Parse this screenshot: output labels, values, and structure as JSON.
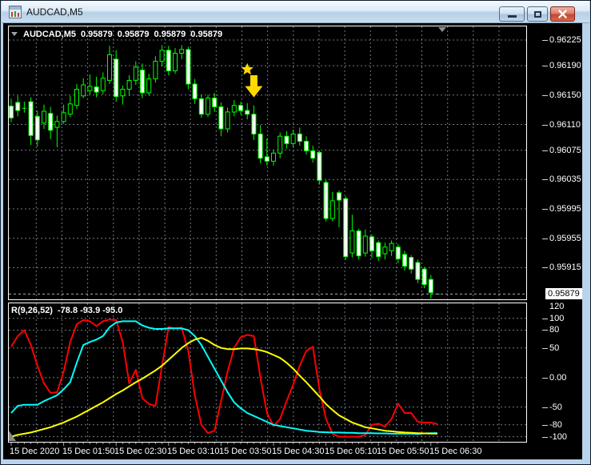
{
  "window": {
    "title": "AUDCAD,M5",
    "buttons": {
      "minimize": "minimize",
      "restore": "restore",
      "close": "close"
    }
  },
  "legend": {
    "symbol": "AUDCAD,M5",
    "open": "0.95879",
    "high": "0.95879",
    "low": "0.95879",
    "close": "0.95879"
  },
  "indicator": {
    "label": "R(9,26,52)",
    "values_text": "-78.8 -93.9 -95.0",
    "axis_labels": [
      "120",
      "100",
      "80",
      "50",
      "0.00",
      "-50",
      "-80",
      "-100"
    ]
  },
  "price_axis": {
    "labels": [
      "0.96225",
      "0.96190",
      "0.96150",
      "0.96110",
      "0.96075",
      "0.96035",
      "0.95995",
      "0.95955",
      "0.95915"
    ],
    "current": "0.95879"
  },
  "time_axis": {
    "labels": [
      {
        "text": "15 Dec 2020",
        "candle_index": 0
      },
      {
        "text": "15 Dec 01:50",
        "candle_index": 8
      },
      {
        "text": "15 Dec 02:30",
        "candle_index": 16
      },
      {
        "text": "15 Dec 03:10",
        "candle_index": 24
      },
      {
        "text": "15 Dec 03:50",
        "candle_index": 32
      },
      {
        "text": "15 Dec 04:30",
        "candle_index": 40
      },
      {
        "text": "15 Dec 05:10",
        "candle_index": 48
      },
      {
        "text": "15 Dec 05:50",
        "candle_index": 56
      },
      {
        "text": "15 Dec 06:30",
        "candle_index": 64
      }
    ]
  },
  "markers": {
    "star": {
      "candle_index": 36,
      "price": 0.96185
    },
    "arrow": {
      "candle_index": 37,
      "top_price": 0.96177,
      "tip_price": 0.96147
    },
    "shift_triangle_x": 552
  },
  "colors": {
    "background": "#000000",
    "border": "#ffffff",
    "grid": "#6e7a88",
    "candle_outline": "#00ff00",
    "bear_fill": "#ffffff",
    "bull_fill": "#000000",
    "price_line": "#a8adb5",
    "r9": "#ff0000",
    "r26": "#00ffff",
    "r52": "#ffff00",
    "marker": "#ffd800",
    "axis_text": "#ffffff"
  },
  "chart_data": [
    {
      "type": "candlestick",
      "title": "AUDCAD,M5",
      "visible_price_range": [
        0.95872,
        0.96245
      ],
      "y_ticks": [
        0.96225,
        0.9619,
        0.9615,
        0.9611,
        0.96075,
        0.96035,
        0.95995,
        0.95955,
        0.95915
      ],
      "current_price": 0.95879,
      "candles": [
        [
          0.96135,
          0.96145,
          0.96113,
          0.96119
        ],
        [
          0.9614,
          0.96149,
          0.96121,
          0.96129
        ],
        [
          0.96132,
          0.96141,
          0.96126,
          0.96133
        ],
        [
          0.96141,
          0.96147,
          0.96082,
          0.96095
        ],
        [
          0.96121,
          0.96129,
          0.9608,
          0.96089
        ],
        [
          0.96112,
          0.96137,
          0.96104,
          0.96128
        ],
        [
          0.96125,
          0.96134,
          0.9609,
          0.96102
        ],
        [
          0.96106,
          0.96122,
          0.96079,
          0.96114
        ],
        [
          0.96114,
          0.96137,
          0.96111,
          0.96126
        ],
        [
          0.96124,
          0.96149,
          0.9612,
          0.96138
        ],
        [
          0.96136,
          0.96165,
          0.96131,
          0.96158
        ],
        [
          0.96149,
          0.96173,
          0.96146,
          0.96164
        ],
        [
          0.96156,
          0.96178,
          0.96151,
          0.96162
        ],
        [
          0.96161,
          0.96175,
          0.96147,
          0.96154
        ],
        [
          0.96156,
          0.96181,
          0.96151,
          0.96173
        ],
        [
          0.9617,
          0.96217,
          0.96165,
          0.96205
        ],
        [
          0.96199,
          0.96211,
          0.96141,
          0.96148
        ],
        [
          0.96149,
          0.96163,
          0.96137,
          0.96158
        ],
        [
          0.96158,
          0.96177,
          0.96149,
          0.9617
        ],
        [
          0.9617,
          0.96196,
          0.96164,
          0.96188
        ],
        [
          0.96184,
          0.96193,
          0.96146,
          0.96153
        ],
        [
          0.96153,
          0.96179,
          0.96149,
          0.96172
        ],
        [
          0.96172,
          0.96203,
          0.96167,
          0.96196
        ],
        [
          0.96196,
          0.96218,
          0.96189,
          0.96211
        ],
        [
          0.96211,
          0.96217,
          0.96177,
          0.96183
        ],
        [
          0.96183,
          0.96214,
          0.96179,
          0.96207
        ],
        [
          0.96207,
          0.96218,
          0.96199,
          0.96212
        ],
        [
          0.96212,
          0.96216,
          0.96158,
          0.96165
        ],
        [
          0.96165,
          0.96172,
          0.96138,
          0.96145
        ],
        [
          0.96145,
          0.96151,
          0.96119,
          0.96124
        ],
        [
          0.96124,
          0.9615,
          0.9612,
          0.96146
        ],
        [
          0.96146,
          0.96153,
          0.96127,
          0.96134
        ],
        [
          0.96134,
          0.9614,
          0.96094,
          0.96104
        ],
        [
          0.96104,
          0.96133,
          0.96099,
          0.96127
        ],
        [
          0.96127,
          0.96143,
          0.96121,
          0.96136
        ],
        [
          0.96136,
          0.96141,
          0.96123,
          0.96129
        ],
        [
          0.96129,
          0.96139,
          0.96117,
          0.96124
        ],
        [
          0.96124,
          0.96136,
          0.96089,
          0.96097
        ],
        [
          0.96097,
          0.96109,
          0.96057,
          0.96064
        ],
        [
          0.96066,
          0.96091,
          0.96054,
          0.9606
        ],
        [
          0.9606,
          0.96076,
          0.96054,
          0.96071
        ],
        [
          0.96071,
          0.96099,
          0.96064,
          0.96094
        ],
        [
          0.96094,
          0.96101,
          0.96077,
          0.96084
        ],
        [
          0.96084,
          0.96103,
          0.96079,
          0.96097
        ],
        [
          0.96097,
          0.96106,
          0.96081,
          0.96087
        ],
        [
          0.96087,
          0.96094,
          0.96069,
          0.96074
        ],
        [
          0.96074,
          0.96081,
          0.96058,
          0.96064
        ],
        [
          0.96072,
          0.96074,
          0.96028,
          0.96034
        ],
        [
          0.96031,
          0.96034,
          0.95978,
          0.95982
        ],
        [
          0.95982,
          0.96018,
          0.95978,
          0.96006
        ],
        [
          0.96017,
          0.9602,
          0.9597,
          0.96007
        ],
        [
          0.96009,
          0.96012,
          0.95926,
          0.9593
        ],
        [
          0.95935,
          0.95987,
          0.95929,
          0.95965
        ],
        [
          0.95965,
          0.95968,
          0.95926,
          0.95931
        ],
        [
          0.95935,
          0.95967,
          0.9593,
          0.95958
        ],
        [
          0.95957,
          0.9596,
          0.95928,
          0.95938
        ],
        [
          0.95949,
          0.95952,
          0.95924,
          0.9593
        ],
        [
          0.95934,
          0.95949,
          0.95926,
          0.95943
        ],
        [
          0.95938,
          0.95952,
          0.95931,
          0.95948
        ],
        [
          0.95943,
          0.95947,
          0.95921,
          0.95927
        ],
        [
          0.95933,
          0.95938,
          0.95911,
          0.95917
        ],
        [
          0.95929,
          0.95932,
          0.95907,
          0.95913
        ],
        [
          0.95922,
          0.95926,
          0.95894,
          0.95899
        ],
        [
          0.95913,
          0.95916,
          0.95887,
          0.95892
        ],
        [
          0.95899,
          0.95905,
          0.95873,
          0.95881
        ],
        [
          0.95879,
          0.95879,
          0.95879,
          0.95879
        ]
      ]
    },
    {
      "type": "line",
      "title": "R(9,26,52)",
      "ylim": [
        -109,
        127
      ],
      "y_ticks": [
        120,
        100,
        80,
        50,
        0,
        -50,
        -80,
        -100
      ],
      "current_values": [
        -78.8,
        -93.9,
        -95.0
      ],
      "series": [
        {
          "name": "R9",
          "color": "#ff0000",
          "values": [
            52,
            70,
            80,
            55,
            20,
            -10,
            -26,
            -25,
            10,
            60,
            90,
            97,
            95,
            87,
            95,
            98,
            97,
            60,
            -10,
            13,
            -35,
            -45,
            -48,
            20,
            85,
            83,
            84,
            45,
            -30,
            -80,
            -94,
            -90,
            -40,
            10,
            50,
            68,
            72,
            70,
            0,
            -60,
            -82,
            -70,
            -40,
            -12,
            20,
            45,
            52,
            -20,
            -70,
            -95,
            -100,
            -100,
            -100,
            -100,
            -97,
            -80,
            -78,
            -83,
            -70,
            -44,
            -60,
            -60,
            -75,
            -76,
            -76,
            -78.8
          ]
        },
        {
          "name": "R26",
          "color": "#00ffff",
          "values": [
            -60,
            -48,
            -46,
            -46,
            -46,
            -40,
            -35,
            -30,
            -20,
            -8,
            25,
            55,
            60,
            64,
            70,
            85,
            93,
            95,
            95,
            95,
            88,
            84,
            82,
            82,
            83,
            83,
            83,
            80,
            70,
            55,
            35,
            15,
            -5,
            -25,
            -42,
            -52,
            -60,
            -65,
            -70,
            -75,
            -80,
            -82,
            -84,
            -86,
            -88,
            -90,
            -91,
            -92,
            -92.5,
            -93,
            -93,
            -93.5,
            -93.5,
            -94,
            -94,
            -94,
            -94.5,
            -94.5,
            -95,
            -95,
            -95,
            -95,
            -95.5,
            -94.5,
            -94,
            -93.9
          ]
        },
        {
          "name": "R52",
          "color": "#ffff00",
          "values": [
            -100,
            -97,
            -95,
            -93,
            -90,
            -87,
            -84,
            -80,
            -76,
            -71,
            -66,
            -60,
            -54,
            -48,
            -42,
            -35,
            -28,
            -22,
            -15,
            -8,
            -2,
            5,
            12,
            20,
            30,
            40,
            50,
            58,
            64,
            67,
            62,
            55,
            50,
            48,
            48,
            49,
            49,
            48,
            46,
            43,
            38,
            33,
            25,
            15,
            3,
            -8,
            -20,
            -32,
            -45,
            -55,
            -64,
            -70,
            -76,
            -80,
            -84,
            -86,
            -88,
            -90,
            -91,
            -92,
            -93,
            -93.5,
            -94,
            -94.5,
            -94.8,
            -95
          ]
        }
      ]
    }
  ]
}
